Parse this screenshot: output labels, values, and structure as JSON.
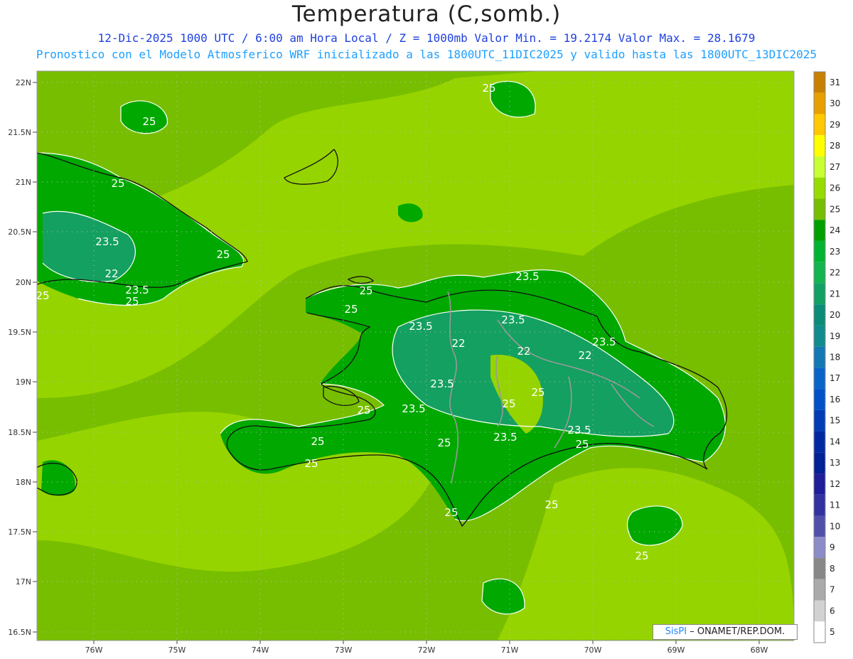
{
  "header": {
    "title": "Temperatura (C,somb.)",
    "line1": "12-Dic-2025  1000 UTC / 6:00 am Hora Local / Z = 1000mb   Valor Min. = 19.2174  Valor Max. = 28.1679",
    "line2": "Pronostico con el Modelo Atmosferico WRF inicializado a las 1800UTC_11DIC2025 y valido hasta las  1800UTC_13DIC2025"
  },
  "axes": {
    "lat_labels": [
      "22N",
      "21.5N",
      "21N",
      "20.5N",
      "20N",
      "19.5N",
      "19N",
      "18.5N",
      "18N",
      "17.5N",
      "17N",
      "16.5N"
    ],
    "lon_labels": [
      "76W",
      "75W",
      "74W",
      "73W",
      "72W",
      "71W",
      "70W",
      "69W",
      "68W"
    ]
  },
  "colorbar": {
    "labels": [
      "31",
      "30",
      "29",
      "28",
      "27",
      "26",
      "25",
      "24",
      "23",
      "22",
      "21",
      "20",
      "19",
      "18",
      "17",
      "16",
      "15",
      "14",
      "13",
      "12",
      "11",
      "10",
      "9",
      "8",
      "7",
      "6",
      "5"
    ],
    "colors": [
      "#c88000",
      "#e8a000",
      "#ffc800",
      "#ffff00",
      "#c8ff32",
      "#96dc00",
      "#78be00",
      "#00a000",
      "#00b432",
      "#14b450",
      "#12a064",
      "#0a8c78",
      "#118c8c",
      "#1478b4",
      "#0a64c8",
      "#0050c8",
      "#003cb4",
      "#0028a0",
      "#002096",
      "#1e1e9a",
      "#3232a0",
      "#5050aa",
      "#8c8cc8",
      "#888888",
      "#aaaaaa",
      "#d2d2d2",
      "#ffffff"
    ],
    "bands": 27
  },
  "contour_labels": [
    {
      "text": "25"
    },
    {
      "text": "25"
    },
    {
      "text": "25"
    },
    {
      "text": "23.5"
    },
    {
      "text": "22"
    },
    {
      "text": "23.5"
    },
    {
      "text": "25"
    },
    {
      "text": "25"
    },
    {
      "text": "25"
    },
    {
      "text": "25"
    },
    {
      "text": "25"
    },
    {
      "text": "23.5"
    },
    {
      "text": "23.5"
    },
    {
      "text": "23.5"
    },
    {
      "text": "22"
    },
    {
      "text": "22"
    },
    {
      "text": "23.5"
    },
    {
      "text": "22"
    },
    {
      "text": "23.5"
    },
    {
      "text": "25"
    },
    {
      "text": "25"
    },
    {
      "text": "23.5"
    },
    {
      "text": "23.5"
    },
    {
      "text": "23.5"
    },
    {
      "text": "25"
    },
    {
      "text": "25"
    },
    {
      "text": "25"
    },
    {
      "text": "25"
    },
    {
      "text": "25"
    },
    {
      "text": "25"
    },
    {
      "text": "25"
    },
    {
      "text": "25"
    }
  ],
  "credit": {
    "brand": "SisPI",
    "text": "– ONAMET/REP.DOM."
  }
}
